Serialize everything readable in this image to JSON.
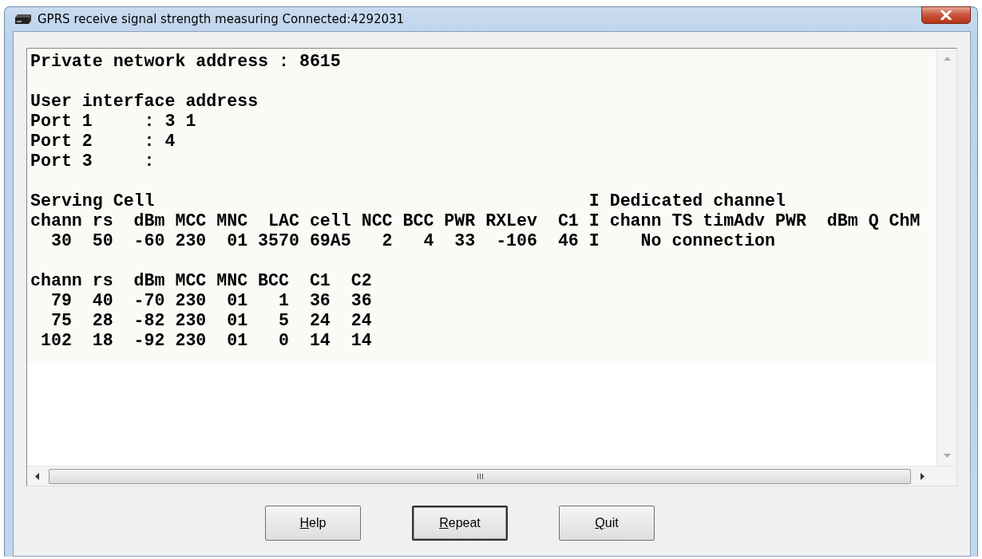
{
  "window": {
    "title": "GPRS receive signal strength measuring Connected:4292031"
  },
  "output": {
    "blocks": [
      [
        "Private network address : 8615"
      ],
      [
        "User interface address",
        "Port 1     : 3 1",
        "Port 2     : 4",
        "Port 3     :"
      ],
      [
        "Serving Cell                                          I Dedicated channel",
        "chann rs  dBm MCC MNC  LAC cell NCC BCC PWR RXLev  C1 I chann TS timAdv PWR  dBm Q ChM",
        "  30  50  -60 230  01 3570 69A5   2   4  33  -106  46 I    No connection"
      ],
      [
        "chann rs  dBm MCC MNC BCC  C1  C2",
        "  79  40  -70 230  01   1  36  36",
        "  75  28  -82 230  01   5  24  24",
        " 102  18  -92 230  01   0  14  14"
      ]
    ]
  },
  "buttons": [
    {
      "label": "Help",
      "default": false
    },
    {
      "label": "Repeat",
      "default": true
    },
    {
      "label": "Quit",
      "default": false
    }
  ]
}
